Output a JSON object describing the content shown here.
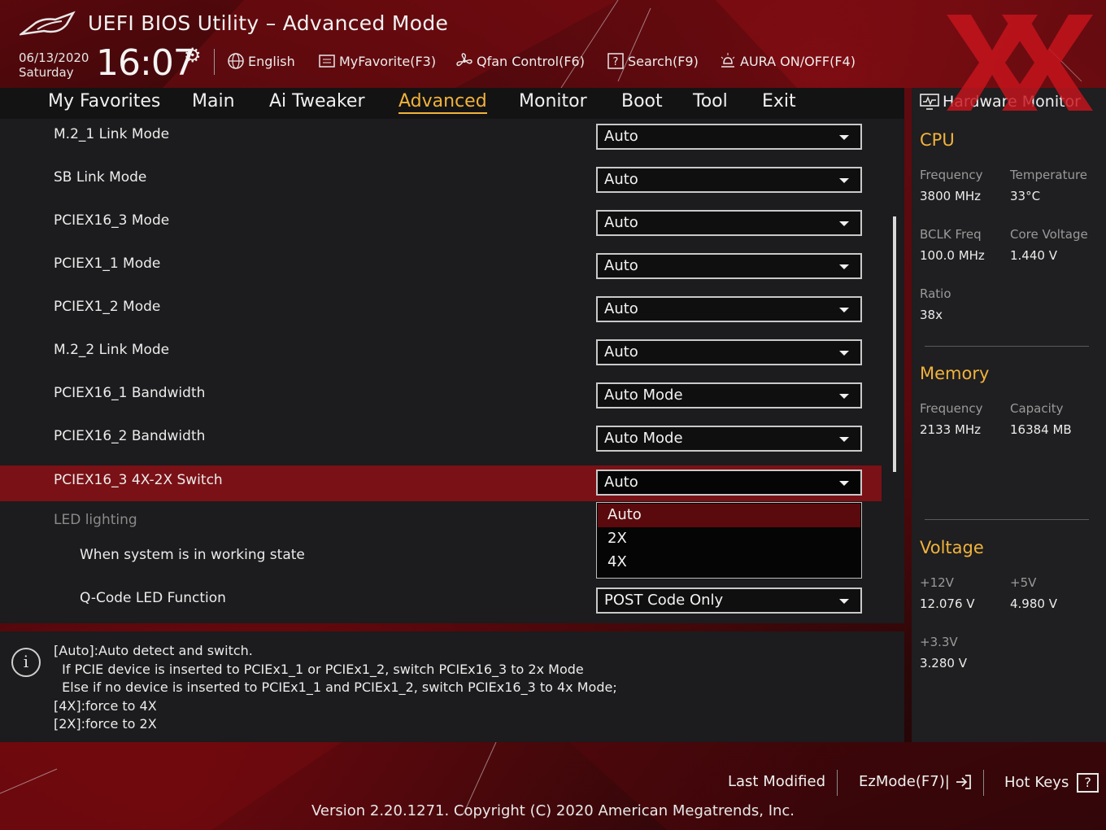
{
  "header": {
    "title": "UEFI BIOS Utility – Advanced Mode",
    "date": "06/13/2020",
    "day": "Saturday",
    "time": "16:07",
    "toolbar": {
      "language": "English",
      "favorite": "MyFavorite(F3)",
      "qfan": "Qfan Control(F6)",
      "search": "Search(F9)",
      "aura": "AURA ON/OFF(F4)"
    }
  },
  "menu": {
    "items": [
      "My Favorites",
      "Main",
      "Ai Tweaker",
      "Advanced",
      "Monitor",
      "Boot",
      "Tool",
      "Exit"
    ],
    "active": "Advanced"
  },
  "settings": {
    "rows": [
      {
        "label": "M.2_1 Link Mode",
        "value": "Auto"
      },
      {
        "label": "SB Link Mode",
        "value": "Auto"
      },
      {
        "label": "PCIEX16_3 Mode",
        "value": "Auto"
      },
      {
        "label": "PCIEX1_1 Mode",
        "value": "Auto"
      },
      {
        "label": "PCIEX1_2 Mode",
        "value": "Auto"
      },
      {
        "label": "M.2_2 Link Mode",
        "value": "Auto"
      },
      {
        "label": "PCIEX16_1 Bandwidth",
        "value": "Auto Mode"
      },
      {
        "label": "PCIEX16_2 Bandwidth",
        "value": "Auto Mode"
      },
      {
        "label": "PCIEX16_3 4X-2X Switch",
        "value": "Auto"
      }
    ],
    "group_label": "LED lighting",
    "working_state_label": "When system is in working state",
    "qcode_label": "Q-Code LED Function",
    "qcode_value": "POST Code Only",
    "dropdown_options": [
      "Auto",
      "2X",
      "4X"
    ],
    "dropdown_selected": "Auto"
  },
  "help": {
    "lines": [
      "[Auto]:Auto detect and switch.",
      "  If PCIE device is inserted to PCIEx1_1 or PCIEx1_2, switch PCIEx16_3 to 2x Mode",
      "  Else if no device is inserted to PCIEx1_1 and PCIEx1_2, switch PCIEx16_3 to 4x Mode;",
      "[4X]:force to 4X",
      "[2X]:force to 2X"
    ],
    "icon": "i"
  },
  "hw_monitor": {
    "title": "Hardware Monitor",
    "cpu": {
      "heading": "CPU",
      "frequency_label": "Frequency",
      "frequency": "3800 MHz",
      "temperature_label": "Temperature",
      "temperature": "33°C",
      "bclk_label": "BCLK Freq",
      "bclk": "100.0 MHz",
      "core_voltage_label": "Core Voltage",
      "core_voltage": "1.440 V",
      "ratio_label": "Ratio",
      "ratio": "38x"
    },
    "memory": {
      "heading": "Memory",
      "frequency_label": "Frequency",
      "frequency": "2133 MHz",
      "capacity_label": "Capacity",
      "capacity": "16384 MB"
    },
    "voltage": {
      "heading": "Voltage",
      "v12_label": "+12V",
      "v12": "12.076 V",
      "v5_label": "+5V",
      "v5": "4.980 V",
      "v33_label": "+3.3V",
      "v33": "3.280 V"
    }
  },
  "footer": {
    "last_modified": "Last Modified",
    "ezmode": "EzMode(F7)|",
    "hotkeys": "Hot Keys",
    "hotkeys_key": "?",
    "version": "Version 2.20.1271. Copyright (C) 2020 American Megatrends, Inc."
  },
  "colors": {
    "accent": "#f0b33c",
    "selected_row": "#7a1116",
    "dropdown_highlight": "#5a0a0d"
  }
}
